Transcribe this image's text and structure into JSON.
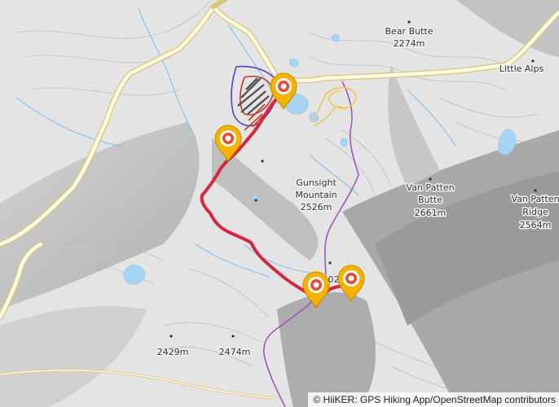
{
  "map": {
    "labels": {
      "bear_butte": {
        "name": "Bear Butte",
        "elevation": "2274m"
      },
      "little_alps": {
        "name": "Little Alps"
      },
      "gunsight": {
        "name_line1": "Gunsight",
        "name_line2": "Mountain",
        "elevation": "2526m"
      },
      "van_patten_butte": {
        "name": "Van Patten",
        "name_line2": "Butte",
        "elevation": "2661m"
      },
      "van_patten_ridge": {
        "name": "Van Patten",
        "name_line2": "Ridge",
        "elevation": "2564m"
      },
      "peak_2429": {
        "elevation": "2429m"
      },
      "peak_2474": {
        "elevation": "2474m"
      },
      "peak_partial": {
        "elevation": "602"
      }
    },
    "markers": [
      {
        "name": "marker-north"
      },
      {
        "name": "marker-west"
      },
      {
        "name": "marker-south-1"
      },
      {
        "name": "marker-south-2"
      }
    ],
    "colors": {
      "terrain": "#e6e6e6",
      "road": "#fffbe0",
      "road_casing": "#d8c47a",
      "track_main": "#d7263d",
      "purple_trail": "#9b59b6",
      "yellow_trail": "#f2c94c",
      "water": "#a7d4f2",
      "marker": "#f5b301"
    }
  },
  "attribution": {
    "text": "© HiiKER: GPS Hiking App/OpenStreetMap contributors"
  }
}
